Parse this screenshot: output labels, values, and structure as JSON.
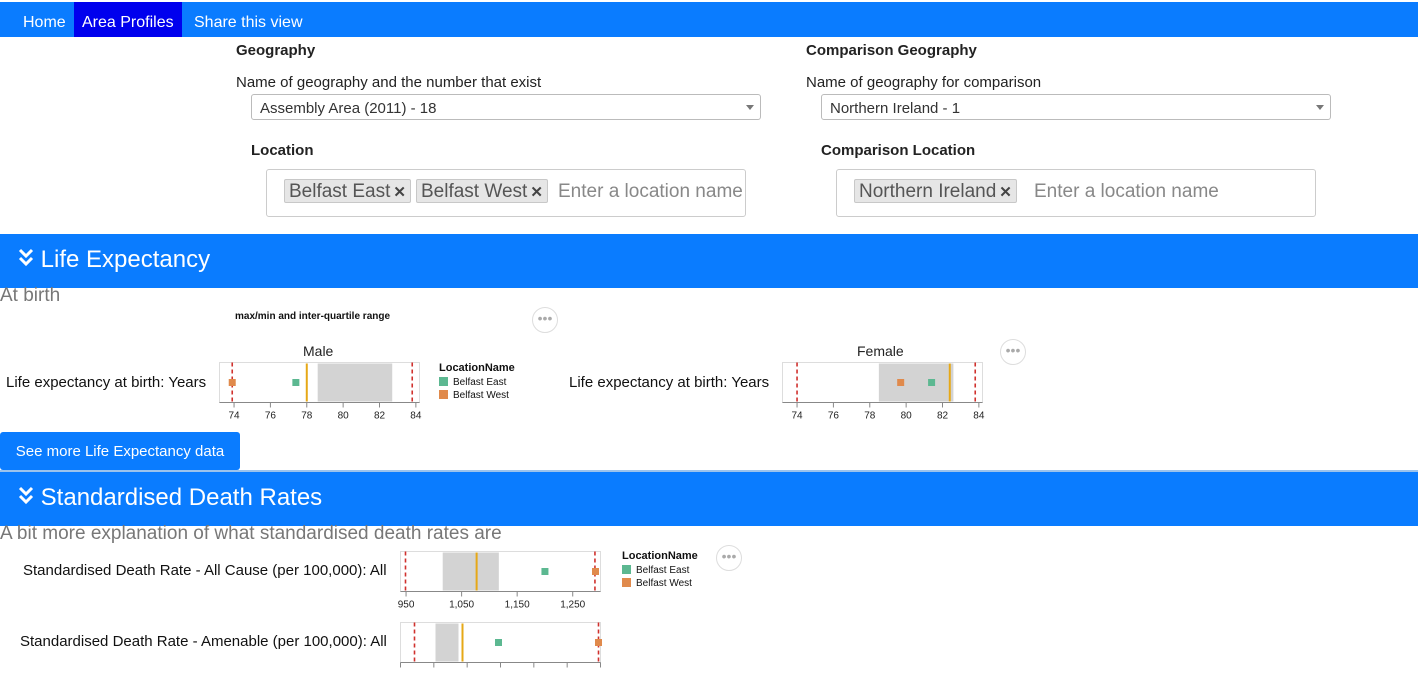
{
  "nav": {
    "home": "Home",
    "area_profiles": "Area Profiles",
    "share": "Share this view"
  },
  "geography": {
    "heading": "Geography",
    "subheading": "Name of geography and the number that exist",
    "selected": "Assembly Area (2011) - 18"
  },
  "comparison_geography": {
    "heading": "Comparison Geography",
    "subheading": "Name of geography for comparison",
    "selected": "Northern Ireland - 1"
  },
  "location": {
    "heading": "Location",
    "tags": [
      "Belfast East",
      "Belfast West"
    ],
    "placeholder": "Enter a location name"
  },
  "comparison_location": {
    "heading": "Comparison Location",
    "tags": [
      "Northern Ireland"
    ],
    "placeholder": "Enter a location name"
  },
  "life_expectancy": {
    "title": "Life Expectancy",
    "note": "At birth",
    "chart_caption": "max/min and inter-quartile range",
    "more_button": "See more Life Expectancy data"
  },
  "death_rates": {
    "title": "Standardised Death Rates",
    "note": "A bit more explanation of what standardised death rates are"
  },
  "legend": {
    "title": "LocationName",
    "items": [
      {
        "label": "Belfast East",
        "color": "#5cb891"
      },
      {
        "label": "Belfast West",
        "color": "#e08a4c"
      }
    ]
  },
  "chart_data": [
    {
      "type": "scatter",
      "title": "Male",
      "row_label": "Life expectancy at birth: Years",
      "xlim": [
        73.2,
        84.2
      ],
      "ticks": [
        "74",
        "76",
        "78",
        "80",
        "82",
        "84"
      ],
      "tick_values": [
        74,
        76,
        78,
        80,
        82,
        84
      ],
      "min": 73.9,
      "max": 83.8,
      "iqr": [
        78.6,
        82.7
      ],
      "comparison": 78.0,
      "series": [
        {
          "name": "Belfast East",
          "value": 77.4
        },
        {
          "name": "Belfast West",
          "value": 73.9
        }
      ]
    },
    {
      "type": "scatter",
      "title": "Female",
      "row_label": "Life expectancy at birth: Years",
      "xlim": [
        73.2,
        84.2
      ],
      "ticks": [
        "74",
        "76",
        "78",
        "80",
        "82",
        "84"
      ],
      "tick_values": [
        74,
        76,
        78,
        80,
        82,
        84
      ],
      "min": 74.0,
      "max": 83.8,
      "iqr": [
        78.5,
        82.6
      ],
      "comparison": 82.4,
      "series": [
        {
          "name": "Belfast East",
          "value": 81.4
        },
        {
          "name": "Belfast West",
          "value": 79.7
        }
      ]
    },
    {
      "type": "scatter",
      "title": "",
      "row_label": "Standardised Death Rate - All Cause (per 100,000): All",
      "xlim": [
        940,
        1300
      ],
      "ticks": [
        "950",
        "1,050",
        "1,150",
        "1,250"
      ],
      "tick_values": [
        950,
        1050,
        1150,
        1250
      ],
      "min": 949,
      "max": 1290,
      "iqr": [
        1016,
        1117
      ],
      "comparison": 1077,
      "series": [
        {
          "name": "Belfast East",
          "value": 1200
        },
        {
          "name": "Belfast West",
          "value": 1291
        }
      ]
    },
    {
      "type": "scatter",
      "title": "",
      "row_label": "Standardised Death Rate - Amenable (per 100,000): All",
      "xlim": [
        0,
        1
      ],
      "ticks": [],
      "tick_values": [],
      "min": 0.07,
      "max": 0.99,
      "iqr": [
        0.175,
        0.29
      ],
      "comparison": 0.31,
      "series": [
        {
          "name": "Belfast East",
          "value": 0.49
        },
        {
          "name": "Belfast West",
          "value": 0.99
        }
      ]
    }
  ]
}
